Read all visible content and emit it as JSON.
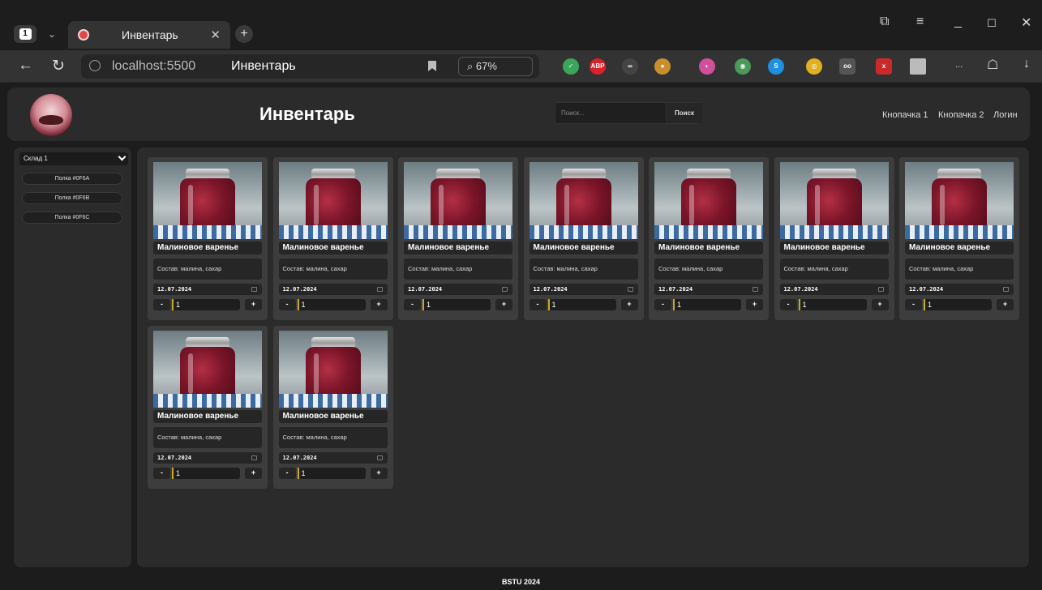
{
  "browser": {
    "tab_count": "1",
    "tab_title": "Инвентарь",
    "url_host": "localhost:5500",
    "url_page_title": "Инвентарь",
    "zoom_label": "67%",
    "overflow_label": "..."
  },
  "header": {
    "title": "Инвентарь",
    "search_placeholder": "Поиск...",
    "search_button": "Поиск",
    "nav": [
      "Кнопачка 1",
      "Кнопачка 2",
      "Логин"
    ]
  },
  "sidebar": {
    "warehouse": "Склад 1",
    "shelves": [
      "Полка #0F6A",
      "Полка #0F6B",
      "Полка #0F6C"
    ]
  },
  "products": [
    {
      "name": "Малиновое варенье",
      "composition": "Состав: малина, сахар",
      "date": "12.07.2024",
      "qty": "1"
    },
    {
      "name": "Малиновое варенье",
      "composition": "Состав: малина, сахар",
      "date": "12.07.2024",
      "qty": "1"
    },
    {
      "name": "Малиновое варенье",
      "composition": "Состав: малина, сахар",
      "date": "12.07.2024",
      "qty": "1"
    },
    {
      "name": "Малиновое варенье",
      "composition": "Состав: малина, сахар",
      "date": "12.07.2024",
      "qty": "1"
    },
    {
      "name": "Малиновое варенье",
      "composition": "Состав: малина, сахар",
      "date": "12.07.2024",
      "qty": "1"
    },
    {
      "name": "Малиновое варенье",
      "composition": "Состав: малина, сахар",
      "date": "12.07.2024",
      "qty": "1"
    },
    {
      "name": "Малиновое варенье",
      "composition": "Состав: малина, сахар",
      "date": "12.07.2024",
      "qty": "1"
    },
    {
      "name": "Малиновое варенье",
      "composition": "Состав: малина, сахар",
      "date": "12.07.2024",
      "qty": "1"
    },
    {
      "name": "Малиновое варенье",
      "composition": "Состав: малина, сахар",
      "date": "12.07.2024",
      "qty": "1"
    }
  ],
  "stepper": {
    "minus": "-",
    "plus": "+"
  },
  "footer": "BSTU 2024",
  "icons": [
    "back-icon",
    "reload-icon",
    "bookmark-icon",
    "shield-ext-icon",
    "abp-ext-icon",
    "calendar-icon"
  ]
}
